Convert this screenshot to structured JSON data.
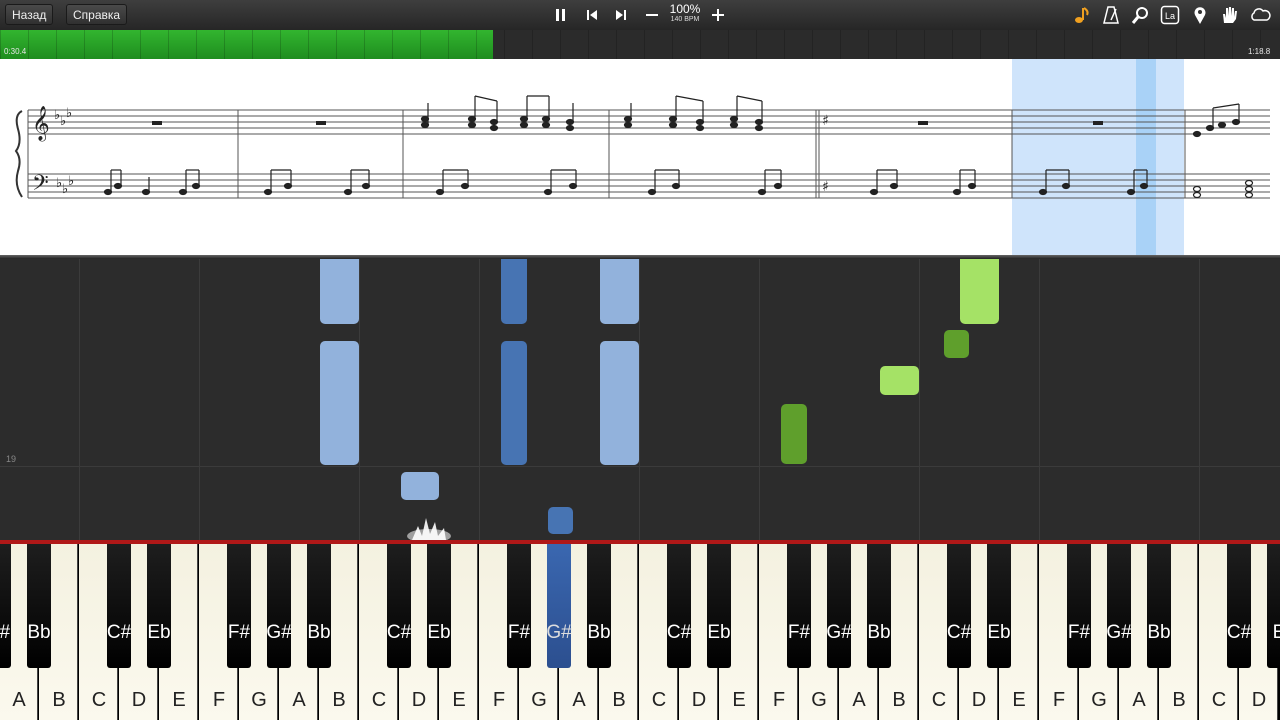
{
  "toolbar": {
    "back_label": "Назад",
    "help_label": "Справка",
    "speed_percent": "100%",
    "tempo": "140 BPM",
    "pause_icon": "pause-icon",
    "prev_icon": "skip-back-icon",
    "next_icon": "skip-forward-icon",
    "right_icons": [
      "note-icon",
      "metronome-icon",
      "magnifier-icon",
      "la-icon",
      "map-pin-icon",
      "hand-icon",
      "cloud-icon"
    ],
    "la_label": "La"
  },
  "progress": {
    "current_time": "0:30.4",
    "total_time": "1:18.8",
    "fraction": 0.385,
    "fill_color": "#2aa82a"
  },
  "roll": {
    "measure_label": "19",
    "colors": {
      "light_blue": "#92b2dc",
      "dark_blue": "#4774b3",
      "light_green": "#a5e266",
      "dark_green": "#5f9f2c"
    }
  },
  "piano": {
    "white_keys": [
      "A",
      "B",
      "C",
      "D",
      "E",
      "F",
      "G",
      "A",
      "B",
      "C",
      "D",
      "E",
      "F",
      "G",
      "A",
      "B",
      "C",
      "D",
      "E",
      "F",
      "G",
      "A",
      "B",
      "C",
      "D",
      "E",
      "F",
      "G",
      "A",
      "B",
      "C",
      "D"
    ],
    "black_keys": [
      "F#",
      "Bb",
      "C#",
      "Eb",
      "F#",
      "G#",
      "Bb",
      "C#",
      "Eb",
      "F#",
      "G#",
      "Bb",
      "C#",
      "Eb",
      "F#",
      "G#",
      "Bb",
      "C#",
      "Eb",
      "F#",
      "G#",
      "Bb",
      "C#",
      "E"
    ],
    "active_key": "G#"
  }
}
